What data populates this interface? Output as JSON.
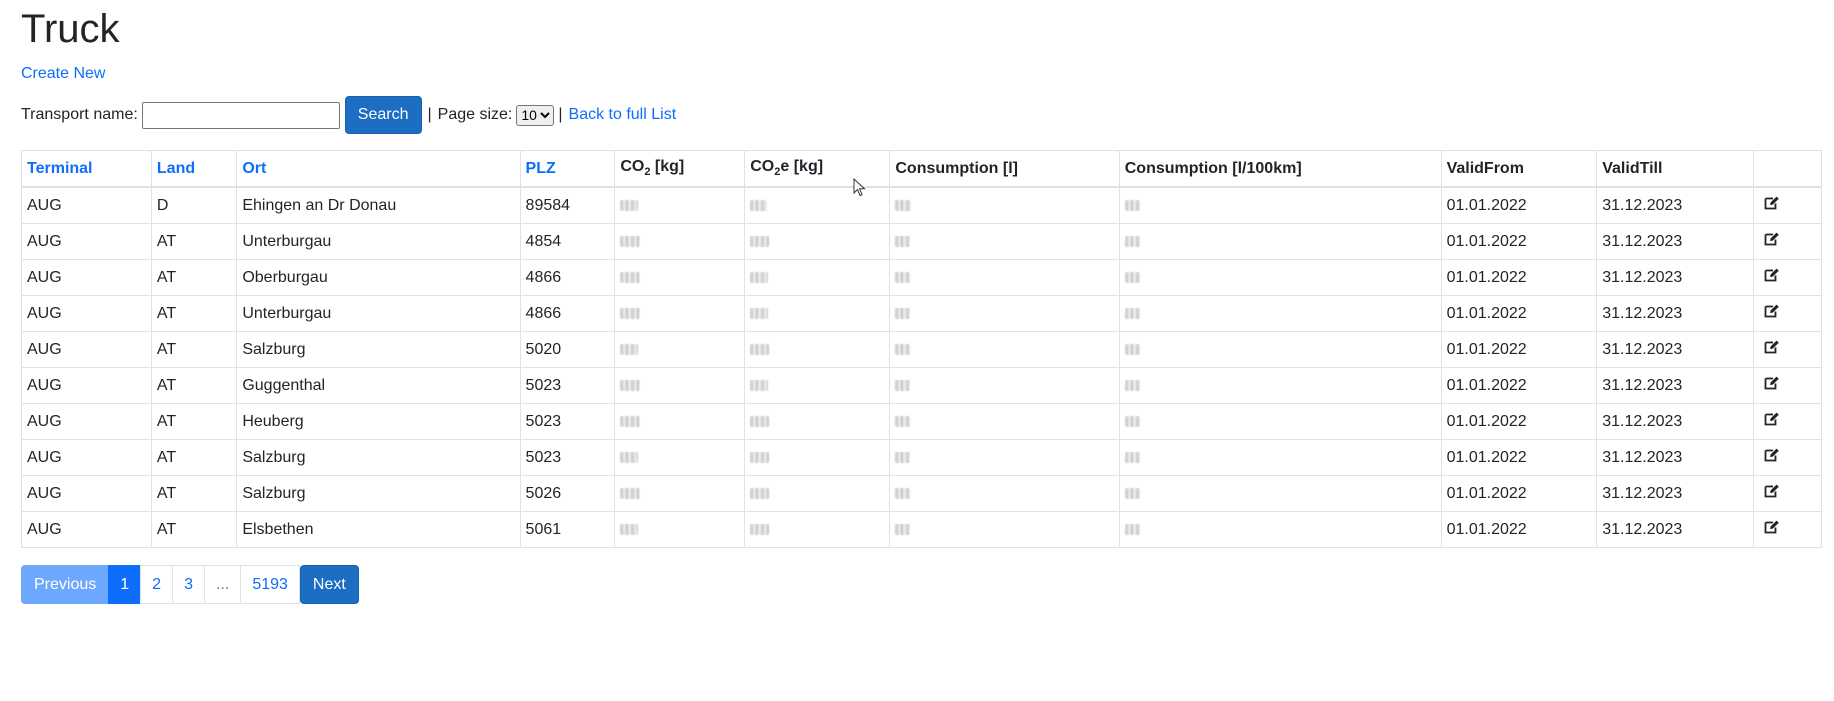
{
  "page": {
    "title": "Truck",
    "create_link": "Create New"
  },
  "search": {
    "label": "Transport name:",
    "value": "",
    "placeholder": "",
    "button": "Search",
    "sep1": "|",
    "page_size_label": "Page size:",
    "page_size_selected": "10",
    "sep2": "|",
    "back_link": "Back to full List"
  },
  "table": {
    "headers": {
      "terminal": "Terminal",
      "land": "Land",
      "ort": "Ort",
      "plz": "PLZ",
      "co2_base": "CO",
      "co2_sub": "2",
      "co2_unit": " [kg]",
      "co2e_base": "CO",
      "co2e_sub": "2",
      "co2e_unit": "e [kg]",
      "consumption": "Consumption [l]",
      "consumption_100": "Consumption [l/100km]",
      "valid_from": "ValidFrom",
      "valid_till": "ValidTill"
    },
    "rows": [
      {
        "terminal": "AUG",
        "land": "D",
        "ort": "Ehingen an Dr Donau",
        "plz": "89584",
        "valid_from": "01.01.2022",
        "valid_till": "31.12.2023"
      },
      {
        "terminal": "AUG",
        "land": "AT",
        "ort": "Unterburgau",
        "plz": "4854",
        "valid_from": "01.01.2022",
        "valid_till": "31.12.2023"
      },
      {
        "terminal": "AUG",
        "land": "AT",
        "ort": "Oberburgau",
        "plz": "4866",
        "valid_from": "01.01.2022",
        "valid_till": "31.12.2023"
      },
      {
        "terminal": "AUG",
        "land": "AT",
        "ort": "Unterburgau",
        "plz": "4866",
        "valid_from": "01.01.2022",
        "valid_till": "31.12.2023"
      },
      {
        "terminal": "AUG",
        "land": "AT",
        "ort": "Salzburg",
        "plz": "5020",
        "valid_from": "01.01.2022",
        "valid_till": "31.12.2023"
      },
      {
        "terminal": "AUG",
        "land": "AT",
        "ort": "Guggenthal",
        "plz": "5023",
        "valid_from": "01.01.2022",
        "valid_till": "31.12.2023"
      },
      {
        "terminal": "AUG",
        "land": "AT",
        "ort": "Heuberg",
        "plz": "5023",
        "valid_from": "01.01.2022",
        "valid_till": "31.12.2023"
      },
      {
        "terminal": "AUG",
        "land": "AT",
        "ort": "Salzburg",
        "plz": "5023",
        "valid_from": "01.01.2022",
        "valid_till": "31.12.2023"
      },
      {
        "terminal": "AUG",
        "land": "AT",
        "ort": "Salzburg",
        "plz": "5026",
        "valid_from": "01.01.2022",
        "valid_till": "31.12.2023"
      },
      {
        "terminal": "AUG",
        "land": "AT",
        "ort": "Elsbethen",
        "plz": "5061",
        "valid_from": "01.01.2022",
        "valid_till": "31.12.2023"
      }
    ]
  },
  "pagination": {
    "previous": "Previous",
    "pages": [
      "1",
      "2",
      "3",
      "...",
      "5193"
    ],
    "next": "Next"
  },
  "icons": {
    "row_action": "edit-icon",
    "pointer": "mouse-cursor-icon"
  },
  "colors": {
    "link": "#0d6efd",
    "primary_button": "#1b6ec2",
    "active_page": "#0d6efd",
    "disabled_previous": "#6ea8fe"
  }
}
